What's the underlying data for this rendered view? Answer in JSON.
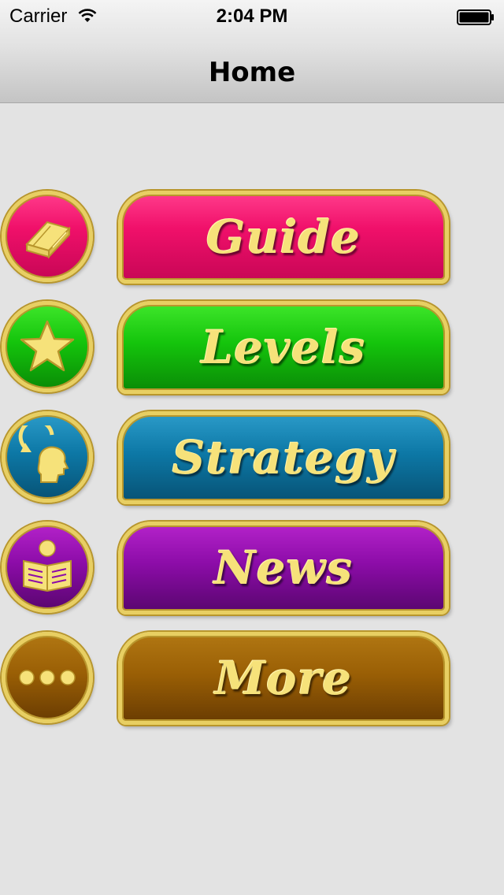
{
  "status_bar": {
    "carrier": "Carrier",
    "time": "2:04 PM",
    "wifi_icon": "wifi-icon",
    "battery_icon": "battery-icon"
  },
  "nav": {
    "title": "Home"
  },
  "menu": [
    {
      "label": "Guide",
      "icon": "book-icon",
      "color": "#f0106a"
    },
    {
      "label": "Levels",
      "icon": "star-icon",
      "color": "#14c40c"
    },
    {
      "label": "Strategy",
      "icon": "head-refresh-icon",
      "color": "#0d78a6"
    },
    {
      "label": "News",
      "icon": "reader-icon",
      "color": "#8c0ca8"
    },
    {
      "label": "More",
      "icon": "ellipsis-icon",
      "color": "#9a5f05"
    }
  ],
  "colors": {
    "gold_border": "#e8cf62",
    "gold_text": "#f6e27a",
    "background": "#e3e3e3"
  }
}
